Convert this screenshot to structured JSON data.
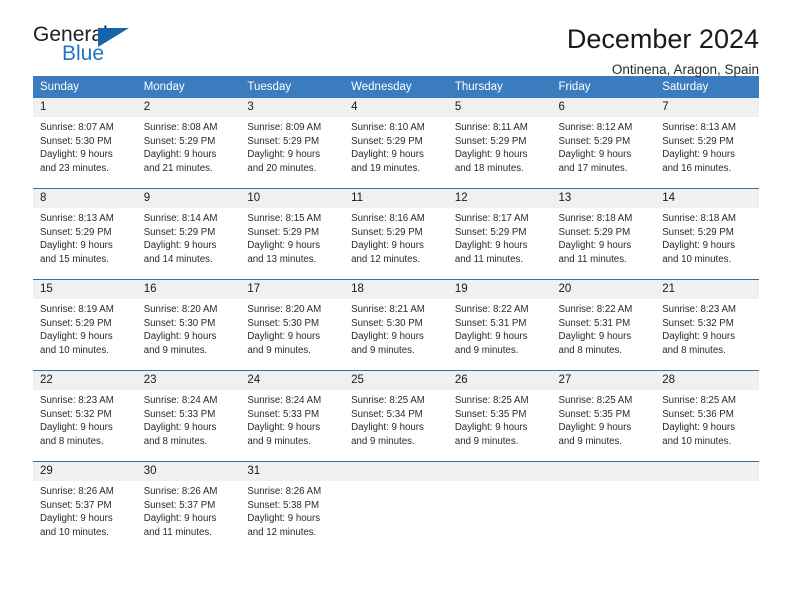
{
  "logo": {
    "word_top": "General",
    "word_bottom": "Blue",
    "triangle_icon": "triangle-icon"
  },
  "header": {
    "title": "December 2024",
    "location": "Ontinena, Aragon, Spain"
  },
  "colors": {
    "header_blue": "#3a7cbe",
    "row_divider": "#2f6fae",
    "daynum_bg": "#f0f0f0",
    "logo_blue": "#1f76c4",
    "text": "#1a1a1a"
  },
  "weekdays": [
    "Sunday",
    "Monday",
    "Tuesday",
    "Wednesday",
    "Thursday",
    "Friday",
    "Saturday"
  ],
  "weeks": [
    [
      {
        "day": "1",
        "sunrise": "Sunrise: 8:07 AM",
        "sunset": "Sunset: 5:30 PM",
        "daylight1": "Daylight: 9 hours",
        "daylight2": "and 23 minutes."
      },
      {
        "day": "2",
        "sunrise": "Sunrise: 8:08 AM",
        "sunset": "Sunset: 5:29 PM",
        "daylight1": "Daylight: 9 hours",
        "daylight2": "and 21 minutes."
      },
      {
        "day": "3",
        "sunrise": "Sunrise: 8:09 AM",
        "sunset": "Sunset: 5:29 PM",
        "daylight1": "Daylight: 9 hours",
        "daylight2": "and 20 minutes."
      },
      {
        "day": "4",
        "sunrise": "Sunrise: 8:10 AM",
        "sunset": "Sunset: 5:29 PM",
        "daylight1": "Daylight: 9 hours",
        "daylight2": "and 19 minutes."
      },
      {
        "day": "5",
        "sunrise": "Sunrise: 8:11 AM",
        "sunset": "Sunset: 5:29 PM",
        "daylight1": "Daylight: 9 hours",
        "daylight2": "and 18 minutes."
      },
      {
        "day": "6",
        "sunrise": "Sunrise: 8:12 AM",
        "sunset": "Sunset: 5:29 PM",
        "daylight1": "Daylight: 9 hours",
        "daylight2": "and 17 minutes."
      },
      {
        "day": "7",
        "sunrise": "Sunrise: 8:13 AM",
        "sunset": "Sunset: 5:29 PM",
        "daylight1": "Daylight: 9 hours",
        "daylight2": "and 16 minutes."
      }
    ],
    [
      {
        "day": "8",
        "sunrise": "Sunrise: 8:13 AM",
        "sunset": "Sunset: 5:29 PM",
        "daylight1": "Daylight: 9 hours",
        "daylight2": "and 15 minutes."
      },
      {
        "day": "9",
        "sunrise": "Sunrise: 8:14 AM",
        "sunset": "Sunset: 5:29 PM",
        "daylight1": "Daylight: 9 hours",
        "daylight2": "and 14 minutes."
      },
      {
        "day": "10",
        "sunrise": "Sunrise: 8:15 AM",
        "sunset": "Sunset: 5:29 PM",
        "daylight1": "Daylight: 9 hours",
        "daylight2": "and 13 minutes."
      },
      {
        "day": "11",
        "sunrise": "Sunrise: 8:16 AM",
        "sunset": "Sunset: 5:29 PM",
        "daylight1": "Daylight: 9 hours",
        "daylight2": "and 12 minutes."
      },
      {
        "day": "12",
        "sunrise": "Sunrise: 8:17 AM",
        "sunset": "Sunset: 5:29 PM",
        "daylight1": "Daylight: 9 hours",
        "daylight2": "and 11 minutes."
      },
      {
        "day": "13",
        "sunrise": "Sunrise: 8:18 AM",
        "sunset": "Sunset: 5:29 PM",
        "daylight1": "Daylight: 9 hours",
        "daylight2": "and 11 minutes."
      },
      {
        "day": "14",
        "sunrise": "Sunrise: 8:18 AM",
        "sunset": "Sunset: 5:29 PM",
        "daylight1": "Daylight: 9 hours",
        "daylight2": "and 10 minutes."
      }
    ],
    [
      {
        "day": "15",
        "sunrise": "Sunrise: 8:19 AM",
        "sunset": "Sunset: 5:29 PM",
        "daylight1": "Daylight: 9 hours",
        "daylight2": "and 10 minutes."
      },
      {
        "day": "16",
        "sunrise": "Sunrise: 8:20 AM",
        "sunset": "Sunset: 5:30 PM",
        "daylight1": "Daylight: 9 hours",
        "daylight2": "and 9 minutes."
      },
      {
        "day": "17",
        "sunrise": "Sunrise: 8:20 AM",
        "sunset": "Sunset: 5:30 PM",
        "daylight1": "Daylight: 9 hours",
        "daylight2": "and 9 minutes."
      },
      {
        "day": "18",
        "sunrise": "Sunrise: 8:21 AM",
        "sunset": "Sunset: 5:30 PM",
        "daylight1": "Daylight: 9 hours",
        "daylight2": "and 9 minutes."
      },
      {
        "day": "19",
        "sunrise": "Sunrise: 8:22 AM",
        "sunset": "Sunset: 5:31 PM",
        "daylight1": "Daylight: 9 hours",
        "daylight2": "and 9 minutes."
      },
      {
        "day": "20",
        "sunrise": "Sunrise: 8:22 AM",
        "sunset": "Sunset: 5:31 PM",
        "daylight1": "Daylight: 9 hours",
        "daylight2": "and 8 minutes."
      },
      {
        "day": "21",
        "sunrise": "Sunrise: 8:23 AM",
        "sunset": "Sunset: 5:32 PM",
        "daylight1": "Daylight: 9 hours",
        "daylight2": "and 8 minutes."
      }
    ],
    [
      {
        "day": "22",
        "sunrise": "Sunrise: 8:23 AM",
        "sunset": "Sunset: 5:32 PM",
        "daylight1": "Daylight: 9 hours",
        "daylight2": "and 8 minutes."
      },
      {
        "day": "23",
        "sunrise": "Sunrise: 8:24 AM",
        "sunset": "Sunset: 5:33 PM",
        "daylight1": "Daylight: 9 hours",
        "daylight2": "and 8 minutes."
      },
      {
        "day": "24",
        "sunrise": "Sunrise: 8:24 AM",
        "sunset": "Sunset: 5:33 PM",
        "daylight1": "Daylight: 9 hours",
        "daylight2": "and 9 minutes."
      },
      {
        "day": "25",
        "sunrise": "Sunrise: 8:25 AM",
        "sunset": "Sunset: 5:34 PM",
        "daylight1": "Daylight: 9 hours",
        "daylight2": "and 9 minutes."
      },
      {
        "day": "26",
        "sunrise": "Sunrise: 8:25 AM",
        "sunset": "Sunset: 5:35 PM",
        "daylight1": "Daylight: 9 hours",
        "daylight2": "and 9 minutes."
      },
      {
        "day": "27",
        "sunrise": "Sunrise: 8:25 AM",
        "sunset": "Sunset: 5:35 PM",
        "daylight1": "Daylight: 9 hours",
        "daylight2": "and 9 minutes."
      },
      {
        "day": "28",
        "sunrise": "Sunrise: 8:25 AM",
        "sunset": "Sunset: 5:36 PM",
        "daylight1": "Daylight: 9 hours",
        "daylight2": "and 10 minutes."
      }
    ],
    [
      {
        "day": "29",
        "sunrise": "Sunrise: 8:26 AM",
        "sunset": "Sunset: 5:37 PM",
        "daylight1": "Daylight: 9 hours",
        "daylight2": "and 10 minutes."
      },
      {
        "day": "30",
        "sunrise": "Sunrise: 8:26 AM",
        "sunset": "Sunset: 5:37 PM",
        "daylight1": "Daylight: 9 hours",
        "daylight2": "and 11 minutes."
      },
      {
        "day": "31",
        "sunrise": "Sunrise: 8:26 AM",
        "sunset": "Sunset: 5:38 PM",
        "daylight1": "Daylight: 9 hours",
        "daylight2": "and 12 minutes."
      },
      {
        "day": "",
        "sunrise": "",
        "sunset": "",
        "daylight1": "",
        "daylight2": ""
      },
      {
        "day": "",
        "sunrise": "",
        "sunset": "",
        "daylight1": "",
        "daylight2": ""
      },
      {
        "day": "",
        "sunrise": "",
        "sunset": "",
        "daylight1": "",
        "daylight2": ""
      },
      {
        "day": "",
        "sunrise": "",
        "sunset": "",
        "daylight1": "",
        "daylight2": ""
      }
    ]
  ]
}
